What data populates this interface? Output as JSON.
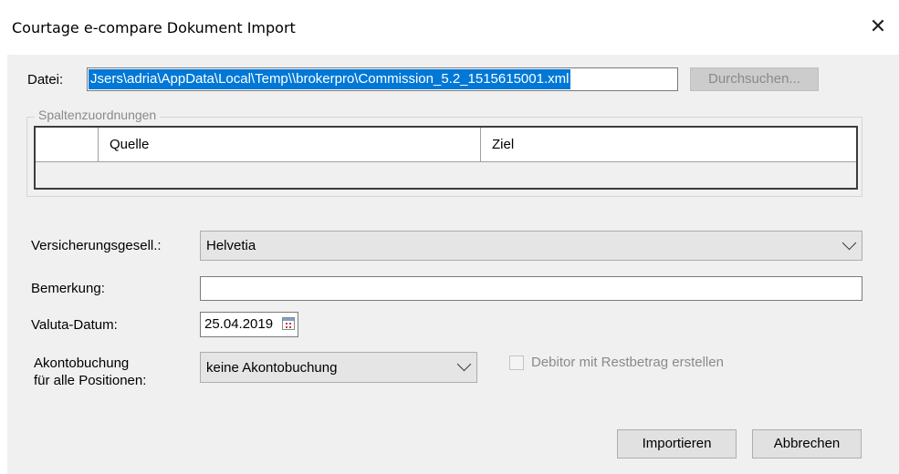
{
  "window": {
    "title": "Courtage e-compare Dokument Import",
    "close_glyph": "✕"
  },
  "file": {
    "label": "Datei:",
    "value": "Jsers\\adria\\AppData\\Local\\Temp\\\\brokerpro\\Commission_5.2_1515615001.xml",
    "browse_label": "Durchsuchen..."
  },
  "mapping": {
    "group_label": "Spaltenzuordnungen",
    "columns": [
      "",
      "Quelle",
      "Ziel"
    ]
  },
  "insurer": {
    "label": "Versicherungsgesell.:",
    "value": "Helvetia"
  },
  "remark": {
    "label": "Bemerkung:",
    "value": ""
  },
  "value_date": {
    "label": "Valuta-Datum:",
    "value": "25.04.2019"
  },
  "advance": {
    "label_line1": "Akontobuchung",
    "label_line2": "für alle Positionen:",
    "value": "keine Akontobuchung"
  },
  "debitor": {
    "label": "Debitor mit Restbetrag erstellen",
    "checked": false
  },
  "actions": {
    "import_label": "Importieren",
    "cancel_label": "Abbrechen"
  }
}
